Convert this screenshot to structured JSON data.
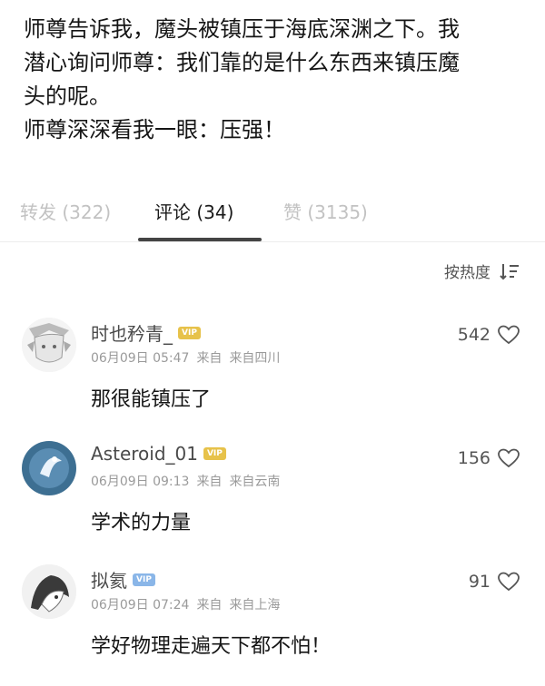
{
  "post": {
    "lines": [
      "师尊告诉我，魔头被镇压于海底深渊之下。我",
      "潜心询问师尊：我们靠的是什么东西来镇压魔",
      "头的呢。",
      "师尊深深看我一眼：压强！"
    ]
  },
  "tabs": [
    {
      "label": "转发 (322)",
      "active": false
    },
    {
      "label": "评论 (34)",
      "active": true
    },
    {
      "label": "赞 (3135)",
      "active": false
    }
  ],
  "sort": {
    "label": "按热度"
  },
  "comments": [
    {
      "username": "时也矜青_",
      "badge": "VIP",
      "time": "06月09日 05:47",
      "source": "来自",
      "location": "来自四川",
      "likes": "542",
      "text": "那很能镇压了"
    },
    {
      "username": "Asteroid_01",
      "badge": "VIP",
      "time": "06月09日 09:13",
      "source": "来自",
      "location": "来自云南",
      "likes": "156",
      "text": "学术的力量"
    },
    {
      "username": "拟氦",
      "badge": "VIP",
      "time": "06月09日 07:24",
      "source": "来自",
      "location": "来自上海",
      "likes": "91",
      "text": "学好物理走遍天下都不怕！"
    }
  ],
  "colors": {
    "accent": "#444444",
    "dim_tab": "#c2c2c2",
    "meta": "#9a9a9a"
  }
}
